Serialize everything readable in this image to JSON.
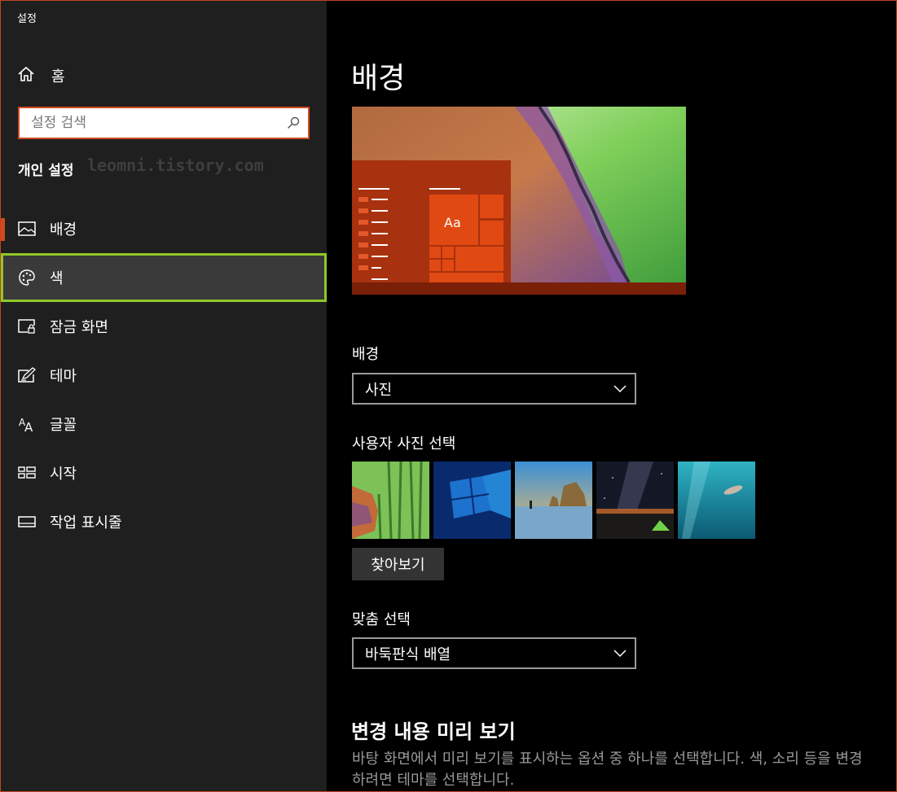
{
  "window": {
    "title": "설정"
  },
  "title_bar": {
    "minimize": "minimize-icon",
    "maximize": "maximize-icon",
    "close": "close-icon"
  },
  "sidebar": {
    "home_label": "홈",
    "search_placeholder": "설정 검색",
    "section_heading": "개인 설정",
    "watermark": "leomni.tistory.com",
    "items": [
      {
        "label": "배경",
        "icon": "picture-icon",
        "selected": true
      },
      {
        "label": "색",
        "icon": "palette-icon",
        "hovered": true
      },
      {
        "label": "잠금 화면",
        "icon": "lock-screen-icon"
      },
      {
        "label": "테마",
        "icon": "theme-icon"
      },
      {
        "label": "글꼴",
        "icon": "font-icon"
      },
      {
        "label": "시작",
        "icon": "start-icon"
      },
      {
        "label": "작업 표시줄",
        "icon": "taskbar-icon"
      }
    ]
  },
  "main": {
    "title": "배경",
    "preview": {
      "tile_text": "Aa"
    },
    "background_label": "배경",
    "background_value": "사진",
    "choose_picture_label": "사용자 사진 선택",
    "thumbnails": [
      "bamboo-forest",
      "windows-10-logo",
      "beach-rock-arch",
      "milky-way-tent",
      "underwater-swimmer"
    ],
    "browse_button": "찾아보기",
    "fit_label": "맞춤 선택",
    "fit_value": "바둑판식 배열",
    "preview_heading": "변경 내용 미리 보기",
    "preview_desc": "바탕 화면에서 미리 보기를 표시하는 옵션 중 하나를 선택합니다. 색, 소리 등을 변경하려면 테마를 선택합니다."
  },
  "colors": {
    "accent": "#d04a1f",
    "hover_outline": "#8fc928",
    "sidebar_bg": "#1f1f1f",
    "main_bg": "#000000"
  }
}
